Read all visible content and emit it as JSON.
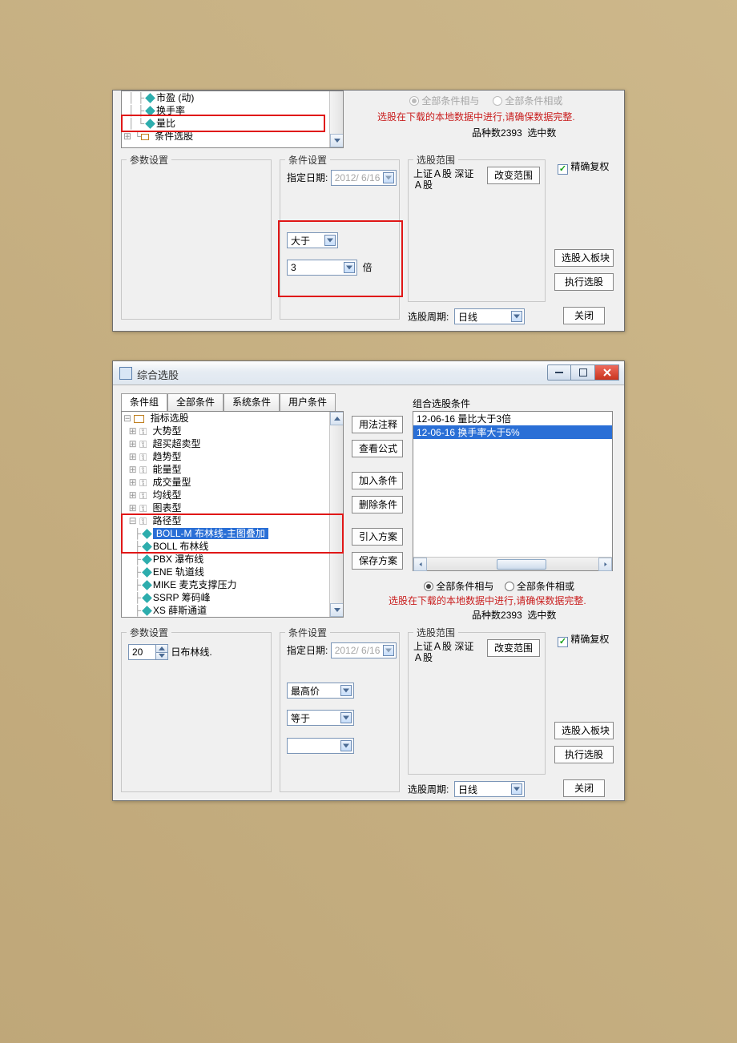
{
  "panel1": {
    "tree_items": [
      "市盈 (动)",
      "换手率",
      "量比",
      "条件选股"
    ],
    "radio_and": "全部条件相与",
    "radio_or": "全部条件相或",
    "warning": "选股在下载的本地数据中进行,请确保数据完整.",
    "stock_count_label": "品种数",
    "stock_count_value": "2393",
    "selected_label": "选中数",
    "group_param": "参数设置",
    "group_cond": "条件设置",
    "group_scope": "选股范围",
    "date_label": "指定日期:",
    "date_value": "2012/ 6/16",
    "op_value": "大于",
    "num_value": "3",
    "num_suffix": "倍",
    "scope_text1": "上证Ａ股 深证",
    "scope_text2": "Ａ股",
    "btn_change_scope": "改变范围",
    "chk_precise": "精确复权",
    "btn_to_block": "选股入板块",
    "btn_run": "执行选股",
    "btn_close": "关闭",
    "period_label": "选股周期:",
    "period_value": "日线"
  },
  "panel2": {
    "title": "综合选股",
    "tabs": [
      "条件组",
      "全部条件",
      "系统条件",
      "用户条件"
    ],
    "tree_root": "指标选股",
    "tree_categories": [
      "大势型",
      "超买超卖型",
      "趋势型",
      "能量型",
      "成交量型",
      "均线型",
      "图表型",
      "路径型"
    ],
    "tree_leaves": [
      "BOLL-M 布林线-主图叠加",
      "BOLL 布林线",
      "PBX 瀑布线",
      "ENE 轨道线",
      "MIKE 麦克支撑压力",
      "SSRP 筹码峰",
      "XS 薛斯通道"
    ],
    "btn_usage": "用法注释",
    "btn_view_formula": "查看公式",
    "btn_add_cond": "加入条件",
    "btn_del_cond": "删除条件",
    "btn_import": "引入方案",
    "btn_save": "保存方案",
    "combined_label": "组合选股条件",
    "combined_item1": "12-06-16  量比大于3倍",
    "combined_item2": "12-06-16  换手率大于5%",
    "radio_and": "全部条件相与",
    "radio_or": "全部条件相或",
    "warning": "选股在下载的本地数据中进行,请确保数据完整.",
    "stock_count_label": "品种数",
    "stock_count_value": "2393",
    "selected_label": "选中数",
    "group_param": "参数设置",
    "param_value": "20",
    "param_suffix": "日布林线.",
    "group_cond": "条件设置",
    "date_label": "指定日期:",
    "date_value": "2012/ 6/16",
    "combo1": "最高价",
    "combo2": "等于",
    "group_scope": "选股范围",
    "scope_text1": "上证Ａ股 深证",
    "scope_text2": "Ａ股",
    "btn_change_scope": "改变范围",
    "chk_precise": "精确复权",
    "btn_to_block": "选股入板块",
    "btn_run": "执行选股",
    "btn_close": "关闭",
    "period_label": "选股周期:",
    "period_value": "日线"
  }
}
